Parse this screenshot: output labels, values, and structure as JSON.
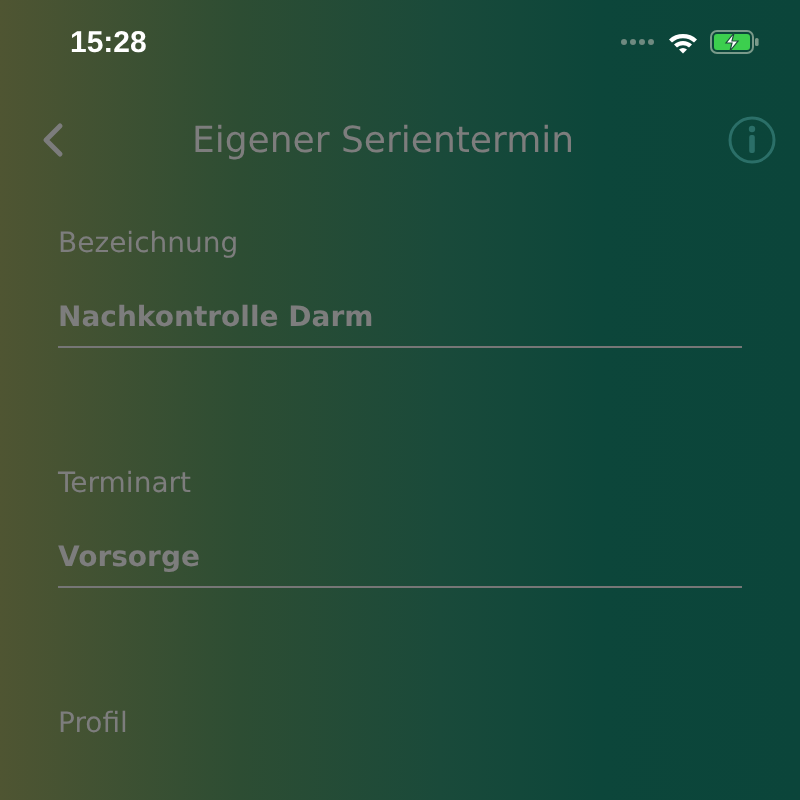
{
  "status_bar": {
    "time": "15:28",
    "battery_charging": true
  },
  "nav": {
    "title": "Eigener Serientermin"
  },
  "fields": [
    {
      "label": "Bezeichnung",
      "value": "Nachkontrolle Darm"
    },
    {
      "label": "Terminart",
      "value": "Vorsorge"
    },
    {
      "label": "Profil"
    }
  ]
}
